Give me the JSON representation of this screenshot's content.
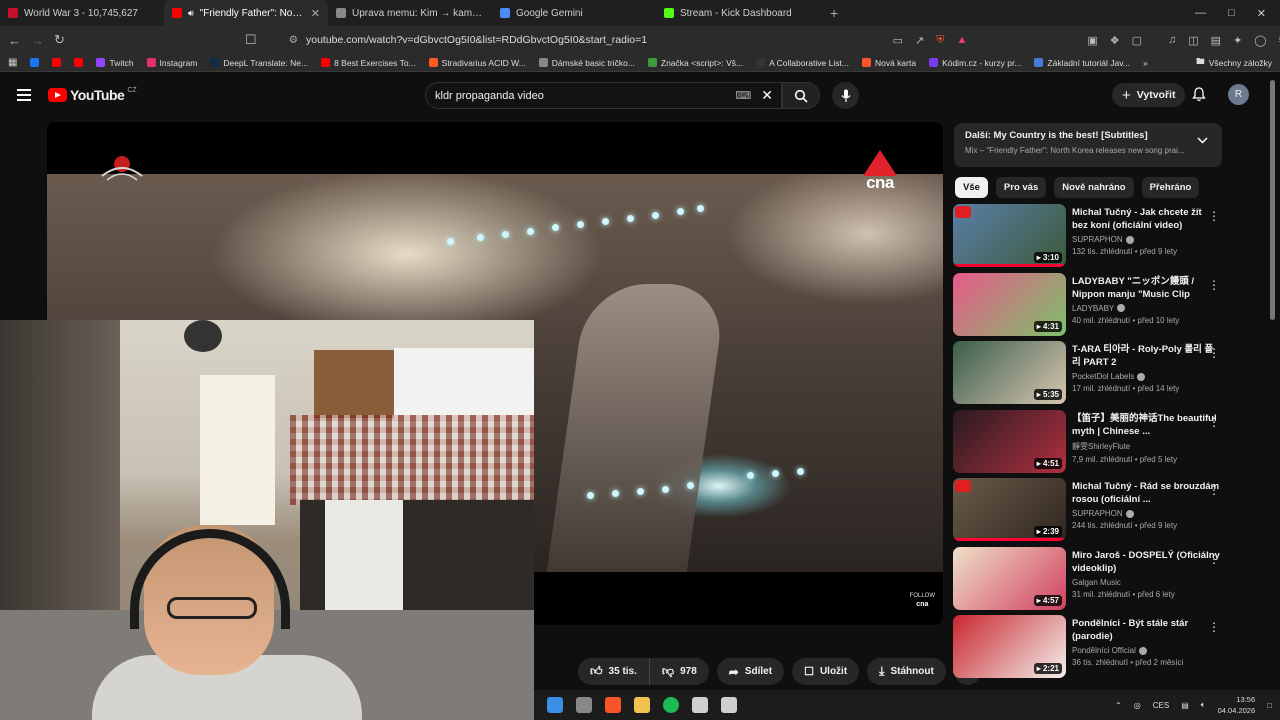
{
  "tabs": [
    {
      "title": "World War 3 - 10,745,627",
      "color": "#c8102e"
    },
    {
      "title": "\"Friendly Father\": North Korea",
      "color": "#ff0000",
      "active": true
    },
    {
      "title": "Úprava memu: Kim → kamarád + izra",
      "color": "#888888"
    },
    {
      "title": "Google Gemini",
      "color": "#4a8df6"
    },
    {
      "title": "Stream - Kick Dashboard",
      "color": "#53fc18"
    }
  ],
  "address": {
    "url": "youtube.com/watch?v=dGbvctOg5I0&list=RDdGbvctOg5I0&start_radio=1"
  },
  "bookmarks": [
    {
      "label": "",
      "color": "#1877f2"
    },
    {
      "label": "",
      "color": "#ff0000"
    },
    {
      "label": "",
      "color": "#ff0000"
    },
    {
      "label": "Twitch",
      "color": "#9146ff"
    },
    {
      "label": "Instagram",
      "color": "#e1306c"
    },
    {
      "label": "DeepL Translate: Ne...",
      "color": "#0f2b46"
    },
    {
      "label": "8 Best Exercises To...",
      "color": "#ff0000"
    },
    {
      "label": "Stradivarius ACID W...",
      "color": "#ff5a1f"
    },
    {
      "label": "Dámské basic tričko...",
      "color": "#888888"
    },
    {
      "label": "Značka <script>: Vš...",
      "color": "#3c9a3c"
    },
    {
      "label": "A Collaborative List...",
      "color": "#333333"
    },
    {
      "label": "Nová karta",
      "color": "#fb542b"
    },
    {
      "label": "Kódim.cz - kurzy pr...",
      "color": "#7a3cf0"
    },
    {
      "label": "Základní tutoriál Jav...",
      "color": "#4a7ad9"
    }
  ],
  "bookmarks_all": "Všechny záložky",
  "youtube": {
    "logo": "YouTube",
    "country": "CZ",
    "search_value": "kldr propaganda video",
    "create_label": "Vytvořit",
    "avatar_letter": "R"
  },
  "player": {
    "channel_logo": "cna",
    "follow_label": "FOLLOW"
  },
  "actions": {
    "like_count": "35 tis.",
    "dislike_count": "978",
    "share_label": "Sdílet",
    "save_label": "Uložit",
    "download_label": "Stáhnout"
  },
  "next_card": {
    "title": "Další: My Country is the best! [Subtitles]",
    "subtitle": "Mix – \"Friendly Father\": North Korea releases new song prai..."
  },
  "chips": [
    "Vše",
    "Pro vás",
    "Nově nahráno",
    "Přehráno"
  ],
  "recommendations": [
    {
      "title": "Michal Tučný - Jak chcete žít bez koní (oficiální video)",
      "channel": "SUPRAPHON",
      "verified": true,
      "meta": "132 tis. zhlédnutí • před 9 lety",
      "duration": "3:10",
      "thumb": [
        "#5a7fa8",
        "#3c5a3a"
      ],
      "mix": true,
      "progress": true
    },
    {
      "title": "LADYBABY \"ニッポン饅頭 / Nippon manju \"Music Clip",
      "channel": "LADYBABY",
      "verified": true,
      "meta": "40 mil. zhlédnutí • před 10 lety",
      "duration": "4:31",
      "thumb": [
        "#e85a8a",
        "#7cc06a"
      ],
      "mix": false,
      "progress": false
    },
    {
      "title": "T-ARA 티아라 - Roly-Poly 롤리 폴리 PART 2",
      "channel": "PocketDol Labels",
      "verified": true,
      "meta": "17 mil. zhlédnutí • před 14 lety",
      "duration": "5:35",
      "thumb": [
        "#3a5e4c",
        "#d7c6b0"
      ],
      "mix": false,
      "progress": false
    },
    {
      "title": "【笛子】美丽的神话The beautiful myth | Chinese ...",
      "channel": "靜雯ShirleyFlute",
      "verified": false,
      "meta": "7,9 mil. zhlédnutí • před 5 lety",
      "duration": "4:51",
      "thumb": [
        "#2a1a20",
        "#b03040"
      ],
      "mix": false,
      "progress": false
    },
    {
      "title": "Michal Tučný - Rád se brouzdám rosou (oficiální ...",
      "channel": "SUPRAPHON",
      "verified": true,
      "meta": "244 tis. zhlédnutí • před 9 lety",
      "duration": "2:39",
      "thumb": [
        "#6a5a48",
        "#2f2620"
      ],
      "mix": true,
      "progress": true
    },
    {
      "title": "Miro Jaroš - DOSPELÝ (Oficiálny videoklip)",
      "channel": "Galgan Music",
      "verified": false,
      "meta": "31 mil. zhlédnutí • před 6 lety",
      "duration": "4:57",
      "thumb": [
        "#f0e0c8",
        "#d04060"
      ],
      "mix": false,
      "progress": false
    },
    {
      "title": "Pondělníci - Být stále stár (parodie)",
      "channel": "Pondělníci Official",
      "verified": true,
      "meta": "36 tis. zhlédnutí • před 2 měsíci",
      "duration": "2:21",
      "thumb": [
        "#c8262e",
        "#f4f0ec"
      ],
      "mix": false,
      "progress": false
    }
  ],
  "taskbar": {
    "icons": [
      "#3a8ee6",
      "#888888",
      "#fb542b",
      "#f2c14e",
      "#1db954",
      "#cfcfcf",
      "#cfcfcf"
    ],
    "lang": "CES",
    "time": "13:56",
    "date": "04.04.2026"
  }
}
